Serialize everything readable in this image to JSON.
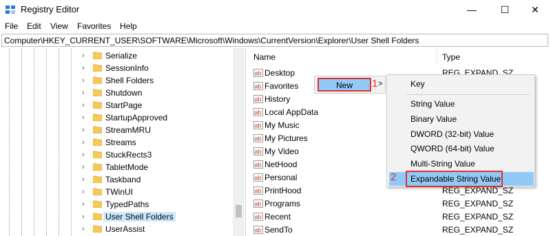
{
  "window": {
    "title": "Registry Editor",
    "controls": {
      "minimize": "—",
      "maximize": "☐",
      "close": "✕"
    }
  },
  "menu": [
    "File",
    "Edit",
    "View",
    "Favorites",
    "Help"
  ],
  "address": "Computer\\HKEY_CURRENT_USER\\SOFTWARE\\Microsoft\\Windows\\CurrentVersion\\Explorer\\User Shell Folders",
  "tree": {
    "items": [
      {
        "label": "Serialize",
        "selected": false
      },
      {
        "label": "SessionInfo",
        "selected": false
      },
      {
        "label": "Shell Folders",
        "selected": false
      },
      {
        "label": "Shutdown",
        "selected": false
      },
      {
        "label": "StartPage",
        "selected": false
      },
      {
        "label": "StartupApproved",
        "selected": false
      },
      {
        "label": "StreamMRU",
        "selected": false
      },
      {
        "label": "Streams",
        "selected": false
      },
      {
        "label": "StuckRects3",
        "selected": false
      },
      {
        "label": "TabletMode",
        "selected": false
      },
      {
        "label": "Taskband",
        "selected": false
      },
      {
        "label": "TWinUI",
        "selected": false
      },
      {
        "label": "TypedPaths",
        "selected": false
      },
      {
        "label": "User Shell Folders",
        "selected": true
      },
      {
        "label": "UserAssist",
        "selected": false
      }
    ]
  },
  "values": {
    "columns": {
      "name": "Name",
      "type": "Type"
    },
    "rows": [
      {
        "name": "Desktop",
        "type": "REG_EXPAND_SZ"
      },
      {
        "name": "Favorites",
        "type": ""
      },
      {
        "name": "History",
        "type": ""
      },
      {
        "name": "Local AppData",
        "type": ""
      },
      {
        "name": "My Music",
        "type": ""
      },
      {
        "name": "My Pictures",
        "type": ""
      },
      {
        "name": "My Video",
        "type": ""
      },
      {
        "name": "NetHood",
        "type": ""
      },
      {
        "name": "Personal",
        "type": ""
      },
      {
        "name": "PrintHood",
        "type": "REG_EXPAND_SZ"
      },
      {
        "name": "Programs",
        "type": "REG_EXPAND_SZ"
      },
      {
        "name": "Recent",
        "type": "REG_EXPAND_SZ"
      },
      {
        "name": "SendTo",
        "type": "REG_EXPAND_SZ"
      }
    ]
  },
  "context_menu": {
    "new_label": "New",
    "step1": "1",
    "arrow": ">"
  },
  "submenu": {
    "key": "Key",
    "items": [
      "String Value",
      "Binary Value",
      "DWORD (32-bit) Value",
      "QWORD (64-bit) Value",
      "Multi-String Value"
    ],
    "highlighted": "Expandable String Value",
    "step2": "2"
  },
  "colors": {
    "highlight": "#91c9f7",
    "annotation": "#e03030",
    "folder": "#f5c95a",
    "selection": "#cce8ff"
  },
  "icons": {
    "app": "registry-editor-icon",
    "folder": "folder-icon",
    "value": "string-value-icon",
    "chevron": "chevron-right-icon"
  }
}
